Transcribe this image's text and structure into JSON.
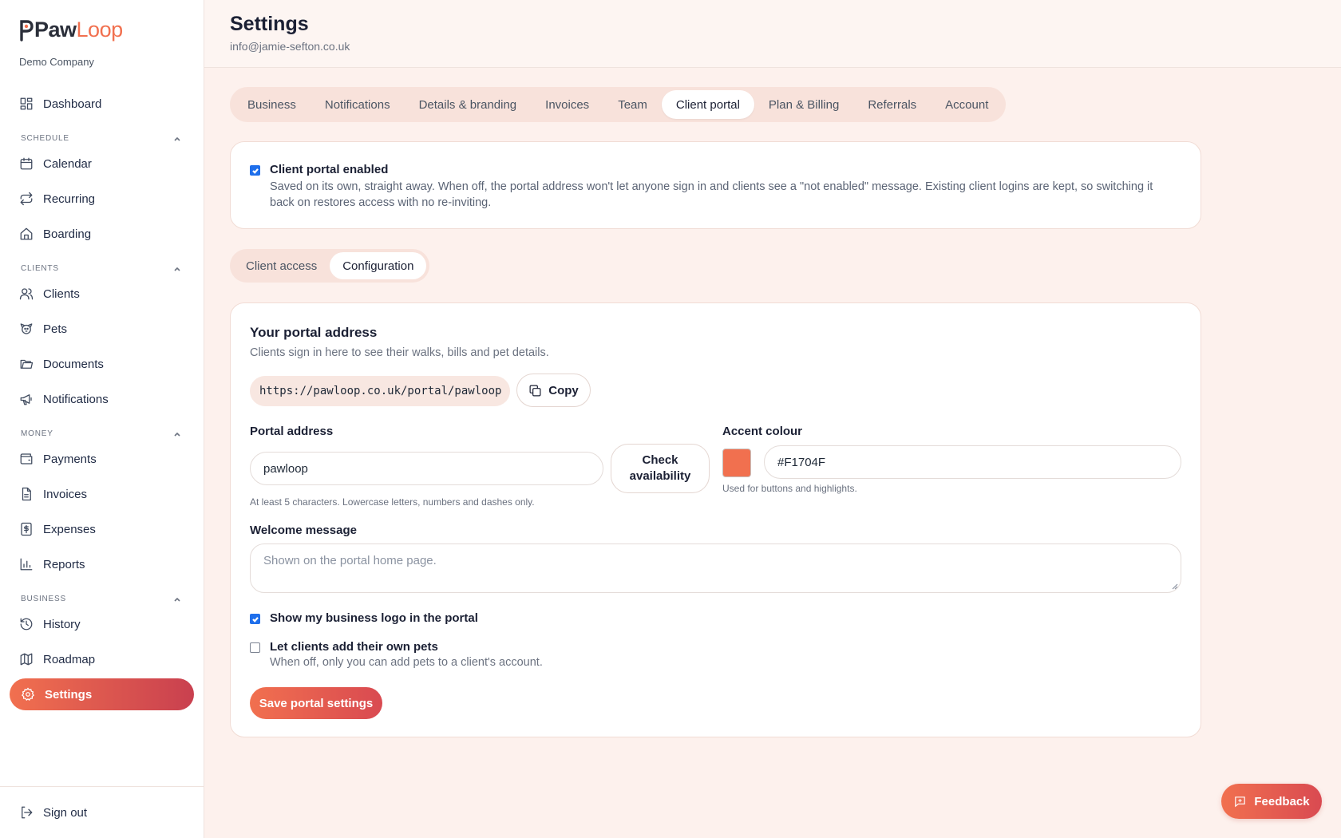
{
  "brand": {
    "logo_text_a": "Paw",
    "logo_text_b": "Loop",
    "company": "Demo Company",
    "accent": "#f1704f"
  },
  "sidebar": {
    "dashboard": "Dashboard",
    "sections": {
      "schedule": "SCHEDULE",
      "clients": "CLIENTS",
      "money": "MONEY",
      "business": "BUSINESS"
    },
    "items": {
      "calendar": "Calendar",
      "recurring": "Recurring",
      "boarding": "Boarding",
      "clients": "Clients",
      "pets": "Pets",
      "documents": "Documents",
      "notifications": "Notifications",
      "payments": "Payments",
      "invoices": "Invoices",
      "expenses": "Expenses",
      "reports": "Reports",
      "history": "History",
      "roadmap": "Roadmap",
      "settings": "Settings"
    },
    "sign_out": "Sign out"
  },
  "header": {
    "title": "Settings",
    "email": "info@jamie-sefton.co.uk"
  },
  "tabs": [
    "Business",
    "Notifications",
    "Details & branding",
    "Invoices",
    "Team",
    "Client portal",
    "Plan & Billing",
    "Referrals",
    "Account"
  ],
  "active_tab": "Client portal",
  "portal_toggle": {
    "checked": true,
    "title": "Client portal enabled",
    "description": "Saved on its own, straight away. When off, the portal address won't let anyone sign in and clients see a \"not enabled\" message. Existing client logins are kept, so switching it back on restores access with no re-inviting."
  },
  "subtabs": [
    "Client access",
    "Configuration"
  ],
  "active_subtab": "Configuration",
  "config": {
    "heading": "Your portal address",
    "subheading": "Clients sign in here to see their walks, bills and pet details.",
    "url": "https://pawloop.co.uk/portal/pawloop",
    "copy_label": "Copy",
    "portal_address_label": "Portal address",
    "portal_address_value": "pawloop",
    "check_label_line1": "Check",
    "check_label_line2": "availability",
    "portal_address_hint": "At least 5 characters. Lowercase letters, numbers and dashes only.",
    "accent_label": "Accent colour",
    "accent_value": "#F1704F",
    "accent_hint": "Used for buttons and highlights.",
    "welcome_label": "Welcome message",
    "welcome_placeholder": "Shown on the portal home page.",
    "show_logo": {
      "checked": true,
      "label": "Show my business logo in the portal"
    },
    "own_pets": {
      "checked": false,
      "label": "Let clients add their own pets",
      "hint": "When off, only you can add pets to a client's account."
    },
    "save_label": "Save portal settings"
  },
  "feedback_label": "Feedback"
}
